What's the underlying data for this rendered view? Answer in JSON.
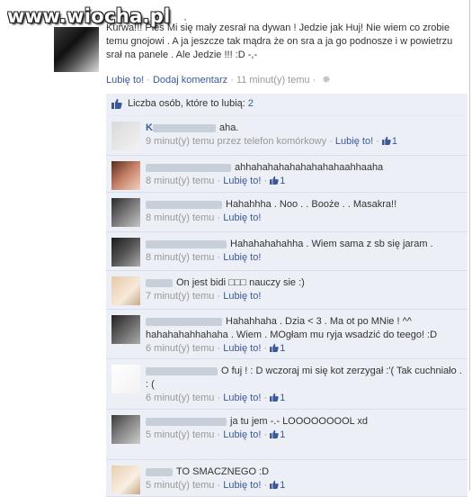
{
  "watermark": "www.wiocha.pl",
  "top_dot": "·",
  "post": {
    "text": "Kurwa!!! Pies Mi się mały zesrał na dywan ! Jedzie jak Huj! Nie wiem co zrobie temu gnojowi . A ja jeszcze tak mądra że on sra a ja go podnosze i w powietrzu srał na panele . Ale Jedzie !!! :D -,-",
    "like": "Lubię to!",
    "sep": " · ",
    "comment": "Dodaj komentarz",
    "time": "11 minut(y) temu"
  },
  "likes": {
    "label": "Liczba osób, które to lubią: ",
    "count": "2"
  },
  "comments": [
    {
      "name": "K",
      "text": "aha.",
      "meta_time": "9 minut(y) temu przez telefon komórkowy",
      "sep": " · ",
      "like": "Lubię to!",
      "sep2": " · ",
      "likes": "1"
    },
    {
      "name": "",
      "text": "ahhahahahahahahahahaahhaaha",
      "meta_time": "8 minut(y) temu",
      "sep": " · ",
      "like": "Lubię to!",
      "sep2": " · ",
      "likes": "1"
    },
    {
      "name": "",
      "text": "Hahahhha . Noo . . Booże . . Masakra!!",
      "meta_time": "8 minut(y) temu",
      "sep": " · ",
      "like": "Lubię to!"
    },
    {
      "name": "",
      "text": "Hahahahahahha . Wiem sama z sb się jaram .",
      "meta_time": "8 minut(y) temu",
      "sep": " · ",
      "like": "Lubię to!"
    },
    {
      "name": "",
      "text": "On jest bidi □□□ nauczy sie :)",
      "meta_time": "7 minut(y) temu",
      "sep": " · ",
      "like": "Lubię to!"
    },
    {
      "name": "",
      "text": "Hahahhaha . Dzia < 3 . Ma ot po MNie ! ^^ hahahahahhahaha . Wiem . MOgłam mu ryja wsadzić do teego! :D",
      "meta_time": "6 minut(y) temu",
      "sep": " · ",
      "like": "Lubię to!",
      "sep2": " · ",
      "likes": "1"
    },
    {
      "name": "",
      "text": "O fuj ! : D wczoraj mi się kot zerzygał :'( Tak cuchniało . : (",
      "meta_time": "6 minut(y) temu",
      "sep": " · ",
      "like": "Lubię to!",
      "sep2": " · ",
      "likes": "1"
    },
    {
      "name": "",
      "text": "ja tu jem -.- LOOOOOOOOL xd",
      "meta_time": "5 minut(y) temu",
      "sep": " · ",
      "like": "Lubię to!",
      "sep2": " · ",
      "likes": "1"
    },
    {
      "name": "",
      "text": "TO SMACZNEGO :D",
      "meta_time": "5 minut(y) temu",
      "sep": " · ",
      "like": "Lubię to!",
      "sep2": " · ",
      "likes": "1"
    }
  ],
  "colors": {
    "link": "#3b5998",
    "meta": "#999999",
    "comment_bg": "#eceff5"
  }
}
